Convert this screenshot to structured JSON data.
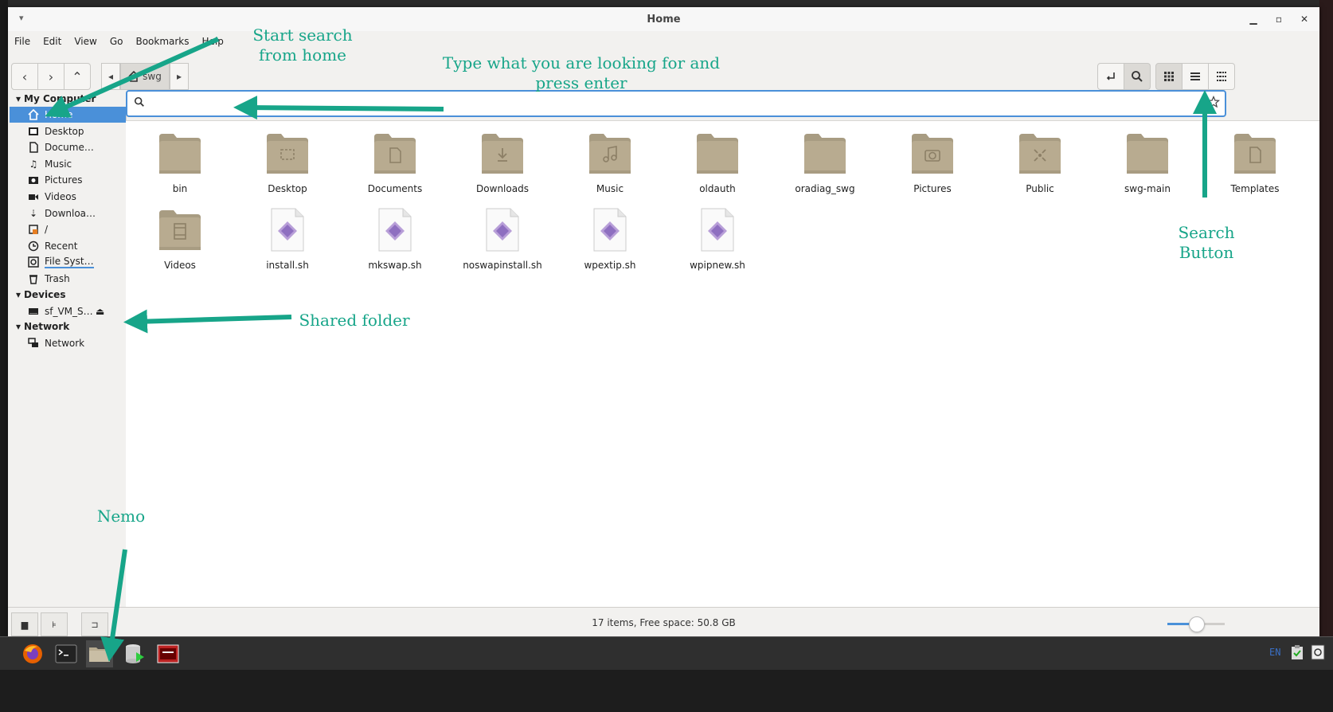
{
  "window": {
    "title": "Home"
  },
  "menu": [
    "File",
    "Edit",
    "View",
    "Go",
    "Bookmarks",
    "Help"
  ],
  "breadcrumb": {
    "current": "swg"
  },
  "sidebar": {
    "sections": [
      {
        "title": "My Computer",
        "items": [
          {
            "label": "Home",
            "icon": "home-icon",
            "selected": true
          },
          {
            "label": "Desktop",
            "icon": "desktop-icon"
          },
          {
            "label": "Docume…",
            "icon": "document-icon"
          },
          {
            "label": "Music",
            "icon": "music-icon"
          },
          {
            "label": "Pictures",
            "icon": "camera-icon"
          },
          {
            "label": "Videos",
            "icon": "video-icon"
          },
          {
            "label": "Downloa…",
            "icon": "download-icon"
          },
          {
            "label": "/",
            "icon": "root-icon"
          },
          {
            "label": "Recent",
            "icon": "clock-icon"
          },
          {
            "label": "File Syst…",
            "icon": "filesystem-icon"
          },
          {
            "label": "Trash",
            "icon": "trash-icon"
          }
        ]
      },
      {
        "title": "Devices",
        "items": [
          {
            "label": "sf_VM_S…",
            "icon": "drive-icon",
            "eject": true
          }
        ]
      },
      {
        "title": "Network",
        "items": [
          {
            "label": "Network",
            "icon": "network-icon"
          }
        ]
      }
    ]
  },
  "search": {
    "value": "",
    "placeholder": ""
  },
  "files": [
    {
      "name": "bin",
      "type": "folder",
      "emblem": ""
    },
    {
      "name": "Desktop",
      "type": "folder",
      "emblem": "desktop"
    },
    {
      "name": "Documents",
      "type": "folder",
      "emblem": "documents"
    },
    {
      "name": "Downloads",
      "type": "folder",
      "emblem": "downloads"
    },
    {
      "name": "Music",
      "type": "folder",
      "emblem": "music"
    },
    {
      "name": "oldauth",
      "type": "folder",
      "emblem": ""
    },
    {
      "name": "oradiag_swg",
      "type": "folder",
      "emblem": ""
    },
    {
      "name": "Pictures",
      "type": "folder",
      "emblem": "pictures"
    },
    {
      "name": "Public",
      "type": "folder",
      "emblem": "public"
    },
    {
      "name": "swg-main",
      "type": "folder",
      "emblem": ""
    },
    {
      "name": "Templates",
      "type": "folder",
      "emblem": "templates"
    },
    {
      "name": "Videos",
      "type": "folder",
      "emblem": "videos"
    },
    {
      "name": "install.sh",
      "type": "script"
    },
    {
      "name": "mkswap.sh",
      "type": "script"
    },
    {
      "name": "noswapinstall.sh",
      "type": "script"
    },
    {
      "name": "wpextip.sh",
      "type": "script"
    },
    {
      "name": "wpipnew.sh",
      "type": "script"
    }
  ],
  "status": {
    "text": "17 items, Free space: 50.8 GB",
    "zoom_fraction": 0.5
  },
  "annotations": {
    "start_search": "Start search\nfrom home",
    "type_what": "Type what you are looking for and\npress enter",
    "search_button": "Search\nButton",
    "shared_folder": "Shared folder",
    "nemo": "Nemo"
  },
  "taskbar": {
    "keyboard_layout": "EN"
  },
  "colors": {
    "accent": "#4a90d9",
    "folder": "#b8ab90",
    "annotation": "#17a589"
  }
}
